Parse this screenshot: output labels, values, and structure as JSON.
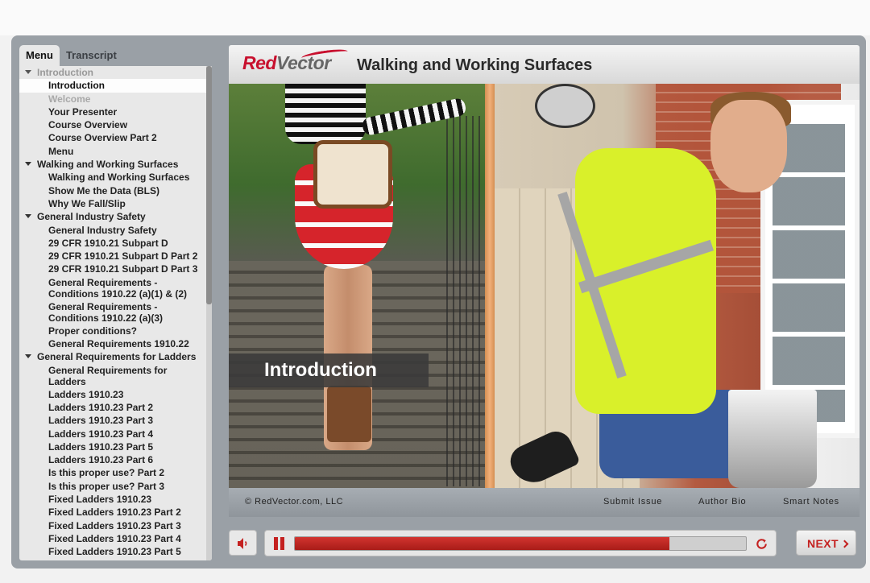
{
  "sidebar": {
    "tabs": [
      {
        "label": "Menu"
      },
      {
        "label": "Transcript"
      }
    ],
    "items": [
      {
        "label": "Introduction",
        "type": "section",
        "state": "dim"
      },
      {
        "label": "Introduction",
        "type": "item",
        "state": "selected"
      },
      {
        "label": "Welcome",
        "type": "item",
        "state": "dim"
      },
      {
        "label": "Your Presenter",
        "type": "item",
        "state": ""
      },
      {
        "label": "Course Overview",
        "type": "item",
        "state": ""
      },
      {
        "label": "Course Overview Part 2",
        "type": "item",
        "state": ""
      },
      {
        "label": "Menu",
        "type": "item",
        "state": ""
      },
      {
        "label": "Walking and Working Surfaces",
        "type": "section",
        "state": ""
      },
      {
        "label": "Walking and Working Surfaces",
        "type": "item",
        "state": ""
      },
      {
        "label": "Show Me the Data (BLS)",
        "type": "item",
        "state": ""
      },
      {
        "label": "Why We Fall/Slip",
        "type": "item",
        "state": ""
      },
      {
        "label": "General Industry Safety",
        "type": "section",
        "state": ""
      },
      {
        "label": "General Industry Safety",
        "type": "item",
        "state": ""
      },
      {
        "label": "29 CFR 1910.21 Subpart D",
        "type": "item",
        "state": ""
      },
      {
        "label": "29 CFR 1910.21 Subpart D Part 2",
        "type": "item",
        "state": ""
      },
      {
        "label": "29 CFR 1910.21 Subpart D Part 3",
        "type": "item",
        "state": ""
      },
      {
        "label": "General Requirements - Conditions 1910.22 (a)(1) & (2)",
        "type": "item",
        "state": ""
      },
      {
        "label": "General Requirements - Conditions 1910.22 (a)(3)",
        "type": "item",
        "state": ""
      },
      {
        "label": "Proper conditions?",
        "type": "item",
        "state": ""
      },
      {
        "label": "General Requirements 1910.22",
        "type": "item",
        "state": ""
      },
      {
        "label": "General Requirements for Ladders",
        "type": "section",
        "state": ""
      },
      {
        "label": "General Requirements for Ladders",
        "type": "item",
        "state": ""
      },
      {
        "label": "Ladders 1910.23",
        "type": "item",
        "state": ""
      },
      {
        "label": "Ladders 1910.23 Part 2",
        "type": "item",
        "state": ""
      },
      {
        "label": "Ladders 1910.23 Part 3",
        "type": "item",
        "state": ""
      },
      {
        "label": "Ladders 1910.23 Part 4",
        "type": "item",
        "state": ""
      },
      {
        "label": "Ladders 1910.23 Part 5",
        "type": "item",
        "state": ""
      },
      {
        "label": "Ladders 1910.23 Part 6",
        "type": "item",
        "state": ""
      },
      {
        "label": "Is this proper use? Part 2",
        "type": "item",
        "state": ""
      },
      {
        "label": "Is this proper use? Part 3",
        "type": "item",
        "state": ""
      },
      {
        "label": "Fixed Ladders 1910.23",
        "type": "item",
        "state": ""
      },
      {
        "label": "Fixed Ladders 1910.23 Part 2",
        "type": "item",
        "state": ""
      },
      {
        "label": "Fixed Ladders 1910.23 Part 3",
        "type": "item",
        "state": ""
      },
      {
        "label": "Fixed Ladders 1910.23 Part 4",
        "type": "item",
        "state": ""
      },
      {
        "label": "Fixed Ladders 1910.23 Part 5",
        "type": "item",
        "state": ""
      }
    ]
  },
  "header": {
    "logo_red": "Red",
    "logo_gray": "Vector",
    "course_title": "Walking and Working Surfaces"
  },
  "slide": {
    "title_overlay": "Introduction"
  },
  "footer": {
    "copyright": "© RedVector.com, LLC",
    "submit_issue": "Submit Issue",
    "author_bio": "Author Bio",
    "smart_notes": "Smart Notes"
  },
  "controls": {
    "progress_fraction": 0.83,
    "next_label": "NEXT",
    "icons": {
      "mute": "speaker-icon",
      "pause": "pause-icon",
      "replay": "replay-icon",
      "next": "chevron-right-icon"
    }
  },
  "colors": {
    "accent_red": "#c42120",
    "brand_red": "#c8102e",
    "panel_gray": "#9aa0a6"
  }
}
